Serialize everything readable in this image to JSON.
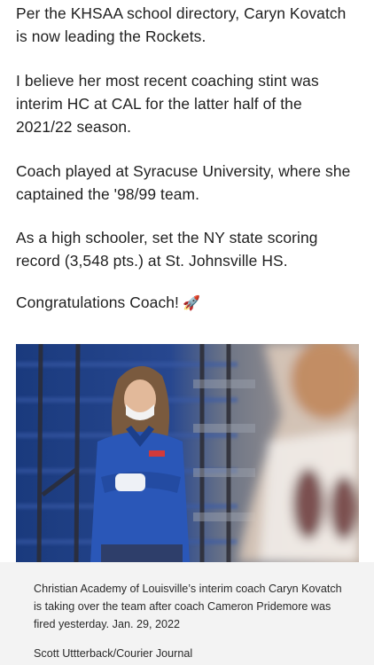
{
  "post": {
    "paragraphs": [
      "Per the KHSAA school directory, Caryn Kovatch is now leading the Rockets.",
      "I believe her most recent coaching stint was interim HC at CAL for the latter half of the 2021/22 season.",
      "Coach played at Syracuse University, where she captained the '98/99 team.",
      "As a high schooler, set the NY state scoring record (3,548 pts.) at St. Johnsville HS.",
      "Congratulations Coach!"
    ],
    "last_emoji": "🚀"
  },
  "photo": {
    "caption": "Christian Academy of Louisville’s interim coach Caryn Kovatch is taking over the team after coach Cameron Pridemore was fired yesterday. Jan. 29, 2022",
    "credit": "Scott Uttterback/Courier Journal"
  },
  "colors": {
    "text": "#1f1f1f",
    "caption_bg": "#f3f3f3",
    "arena_blue": "#1d3f86",
    "jacket_blue": "#2a57b8"
  }
}
